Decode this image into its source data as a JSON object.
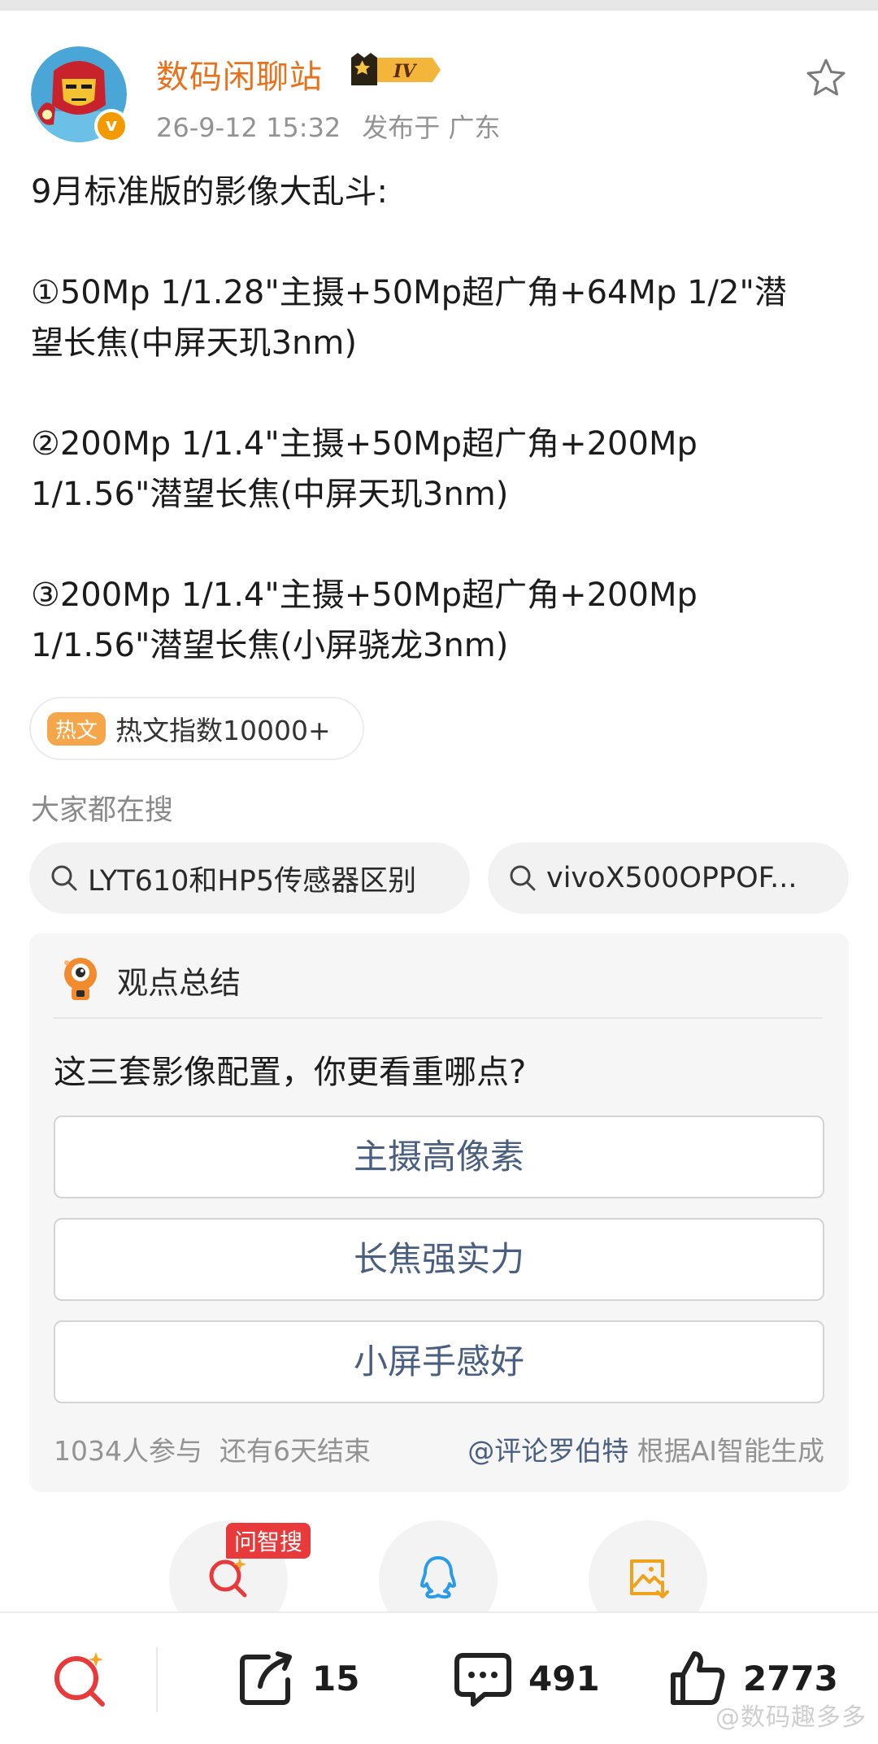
{
  "post": {
    "author": "数码闲聊站",
    "level": "IV",
    "timestamp": "26-9-12 15:32",
    "location": "发布于 广东",
    "lines": [
      "9月标准版的影像大乱斗:",
      "",
      "①50Mp 1/1.28\"主摄+50Mp超广角+64Mp 1/2\"潜",
      "望长焦(中屏天玑3nm)",
      "",
      "②200Mp 1/1.4\"主摄+50Mp超广角+200Mp",
      "1/1.56\"潜望长焦(中屏天玑3nm)",
      "",
      "③200Mp 1/1.4\"主摄+50Mp超广角+200Mp",
      "1/1.56\"潜望长焦(小屏骁龙3nm)"
    ]
  },
  "hot": {
    "tag": "热文",
    "text": "热文指数10000+"
  },
  "search": {
    "heading": "大家都在搜",
    "chips": [
      "LYT610和HP5传感器区别",
      "vivoX500OPPOF..."
    ]
  },
  "summary": {
    "title": "观点总结",
    "question": "这三套影像配置，你更看重哪点?",
    "options": [
      "主摄高像素",
      "长焦强实力",
      "小屏手感好"
    ],
    "participants": "1034人参与",
    "remaining": "还有6天结束",
    "mention": "@评论罗伯特",
    "generated": "根据AI智能生成"
  },
  "floating": {
    "badge": "问智搜"
  },
  "bottom": {
    "share_count": "15",
    "comment_count": "491",
    "like_count": "2773"
  },
  "watermark": "@数码趣多多",
  "colors": {
    "author": "#e9711c",
    "accent_red": "#e8393b",
    "option_text": "#4a5f80"
  }
}
